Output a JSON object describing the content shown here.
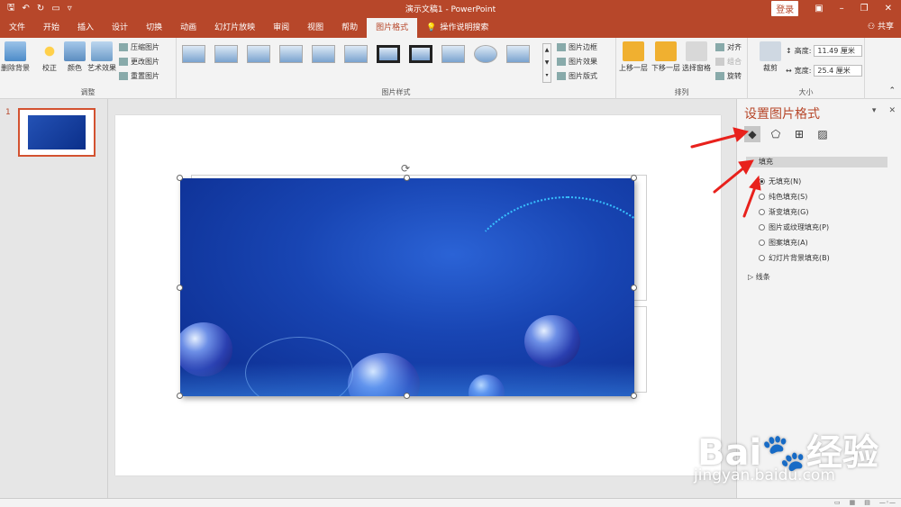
{
  "titlebar": {
    "doc_title": "演示文稿1  -  PowerPoint",
    "login": "登录",
    "share": "共享"
  },
  "tabs": [
    {
      "label": "文件"
    },
    {
      "label": "开始"
    },
    {
      "label": "插入"
    },
    {
      "label": "设计"
    },
    {
      "label": "切换"
    },
    {
      "label": "动画"
    },
    {
      "label": "幻灯片放映"
    },
    {
      "label": "审阅"
    },
    {
      "label": "视图"
    },
    {
      "label": "帮助"
    },
    {
      "label": "图片格式"
    }
  ],
  "tellme": "操作说明搜索",
  "ribbon": {
    "adjust": {
      "remove_bg": "删除背景",
      "correct": "校正",
      "color": "颜色",
      "art_effect": "艺术效果",
      "compress": "压缩图片",
      "change": "更改图片",
      "reset": "重置图片",
      "label": "调整"
    },
    "styles": {
      "border": "图片边框",
      "effect": "图片效果",
      "layout": "图片版式",
      "label": "图片样式"
    },
    "arrange": {
      "forward": "上移一层",
      "backward": "下移一层",
      "selection_pane": "选择窗格",
      "align": "对齐",
      "group": "组合",
      "rotate": "旋转",
      "label": "排列"
    },
    "size": {
      "crop": "裁剪",
      "height_label": "高度:",
      "height_value": "11.49 厘米",
      "width_label": "宽度:",
      "width_value": "25.4 厘米",
      "label": "大小"
    }
  },
  "slides": [
    {
      "num": "1"
    }
  ],
  "pane": {
    "title": "设置图片格式",
    "fill_section": "填充",
    "fill_options": [
      {
        "label": "无填充(N)",
        "selected": true
      },
      {
        "label": "纯色填充(S)",
        "selected": false
      },
      {
        "label": "渐变填充(G)",
        "selected": false
      },
      {
        "label": "图片或纹理填充(P)",
        "selected": false
      },
      {
        "label": "图案填充(A)",
        "selected": false
      },
      {
        "label": "幻灯片背景填充(B)",
        "selected": false
      }
    ],
    "line_section": "线条"
  },
  "watermark": {
    "brand": "Bai",
    "brand_cn": "经验",
    "url": "jingyan.baidu.com"
  },
  "colors": {
    "accent": "#b7472a",
    "arrow": "#e8211c"
  }
}
